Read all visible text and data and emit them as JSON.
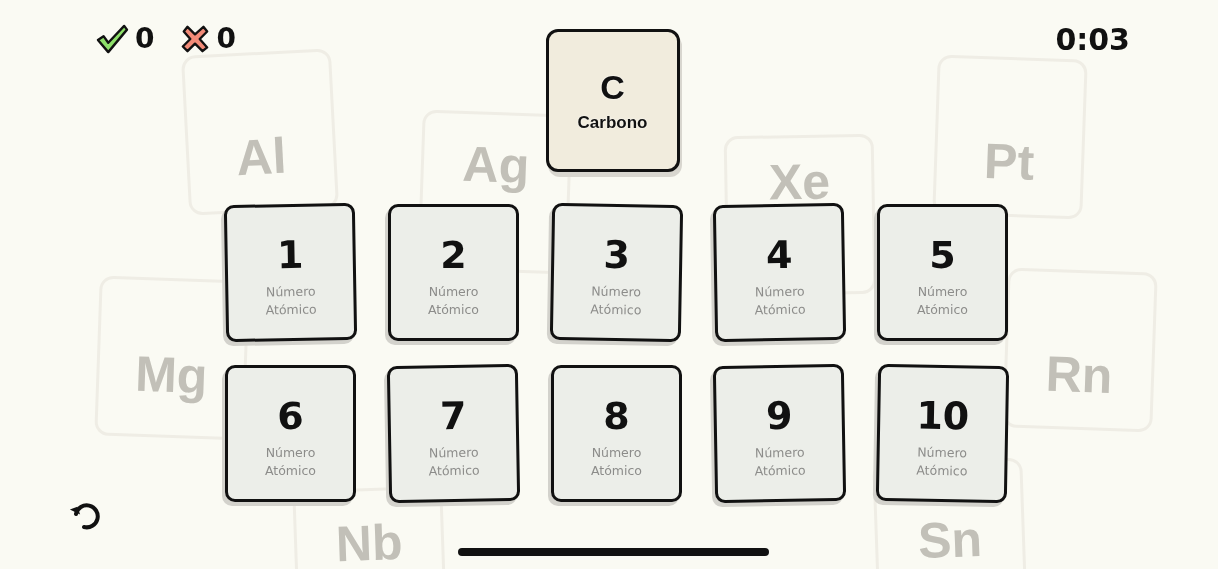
{
  "score": {
    "correct": "0",
    "wrong": "0"
  },
  "timer": "0:03",
  "target": {
    "symbol": "C",
    "name": "Carbono"
  },
  "choices": [
    {
      "value": "1",
      "label": "Número Atómico"
    },
    {
      "value": "2",
      "label": "Número Atómico"
    },
    {
      "value": "3",
      "label": "Número Atómico"
    },
    {
      "value": "4",
      "label": "Número Atómico"
    },
    {
      "value": "5",
      "label": "Número Atómico"
    },
    {
      "value": "6",
      "label": "Número Atómico"
    },
    {
      "value": "7",
      "label": "Número Atómico"
    },
    {
      "value": "8",
      "label": "Número Atómico"
    },
    {
      "value": "9",
      "label": "Número Atómico"
    },
    {
      "value": "10",
      "label": "Número Atómico"
    }
  ],
  "background_tiles": [
    {
      "symbol": "Al"
    },
    {
      "symbol": "Ag"
    },
    {
      "symbol": "Xe"
    },
    {
      "symbol": "Pt"
    },
    {
      "symbol": "Mg"
    },
    {
      "symbol": "Rn"
    },
    {
      "symbol": "Nb"
    },
    {
      "symbol": "Sn"
    }
  ]
}
